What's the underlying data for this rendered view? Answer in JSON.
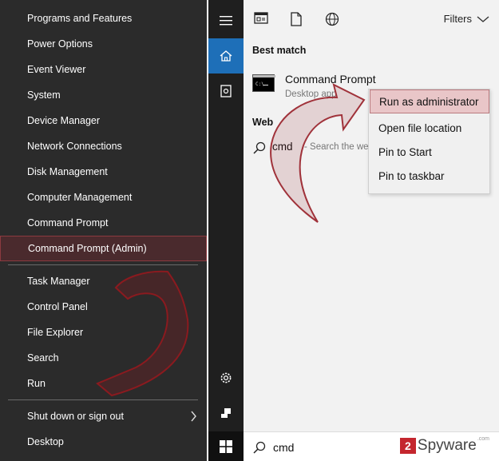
{
  "winx_menu": {
    "items": [
      {
        "label": "Programs and Features"
      },
      {
        "label": "Power Options"
      },
      {
        "label": "Event Viewer"
      },
      {
        "label": "System"
      },
      {
        "label": "Device Manager"
      },
      {
        "label": "Network Connections"
      },
      {
        "label": "Disk Management"
      },
      {
        "label": "Computer Management"
      },
      {
        "label": "Command Prompt"
      },
      {
        "label": "Command Prompt (Admin)"
      },
      {
        "label": "Task Manager"
      },
      {
        "label": "Control Panel"
      },
      {
        "label": "File Explorer"
      },
      {
        "label": "Search"
      },
      {
        "label": "Run"
      },
      {
        "label": "Shut down or sign out"
      },
      {
        "label": "Desktop"
      }
    ],
    "highlighted_item": "Command Prompt (Admin)"
  },
  "search_panel": {
    "filters_label": "Filters",
    "best_match_title": "Best match",
    "best_match": {
      "title": "Command Prompt",
      "subtitle": "Desktop app"
    },
    "web_title": "Web",
    "web_result": {
      "query": "cmd",
      "hint": "- Search the web"
    },
    "context_menu": [
      {
        "label": "Run as administrator"
      },
      {
        "label": "Open file location"
      },
      {
        "label": "Pin to Start"
      },
      {
        "label": "Pin to taskbar"
      }
    ],
    "highlighted_context_item": "Run as administrator",
    "search_box_value": "cmd"
  },
  "watermark": {
    "badge": "2",
    "text": "Spyware",
    "suffix": ".com"
  },
  "colors": {
    "menu_bg": "#2b2b2b",
    "highlight_dark": "#4a2a2d",
    "highlight_light": "#e9c6c8",
    "accent_blue": "#1e6fb8",
    "annotation_red": "#8b1a1f"
  }
}
